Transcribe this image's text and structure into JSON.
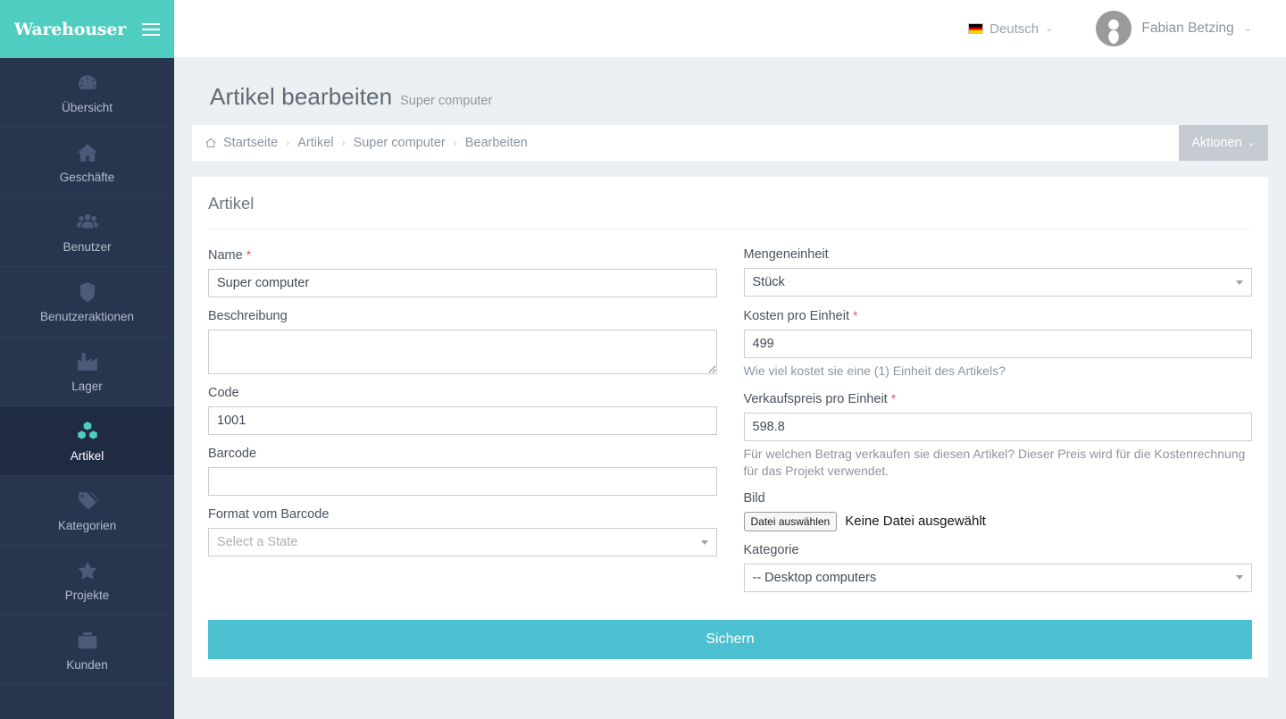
{
  "brand": {
    "name": "Warehouser"
  },
  "sidebar": {
    "items": [
      {
        "label": "Übersicht",
        "icon": "dashboard-icon",
        "active": false
      },
      {
        "label": "Geschäfte",
        "icon": "home-icon",
        "active": false
      },
      {
        "label": "Benutzer",
        "icon": "users-icon",
        "active": false
      },
      {
        "label": "Benutzeraktionen",
        "icon": "shield-icon",
        "active": false
      },
      {
        "label": "Lager",
        "icon": "factory-icon",
        "active": false
      },
      {
        "label": "Artikel",
        "icon": "boxes-icon",
        "active": true
      },
      {
        "label": "Kategorien",
        "icon": "tags-icon",
        "active": false
      },
      {
        "label": "Projekte",
        "icon": "star-icon",
        "active": false
      },
      {
        "label": "Kunden",
        "icon": "briefcase-icon",
        "active": false
      }
    ]
  },
  "topbar": {
    "language": "Deutsch",
    "language_flag": "de-flag-icon",
    "user_name": "Fabian Betzing",
    "avatar": "user-avatar-icon"
  },
  "page": {
    "title": "Artikel bearbeiten",
    "subtitle": "Super computer"
  },
  "breadcrumb": {
    "home_icon": "home-icon",
    "items": [
      "Startseite",
      "Artikel",
      "Super computer",
      "Bearbeiten"
    ],
    "separator": "›",
    "actions_label": "Aktionen"
  },
  "form": {
    "card_title": "Artikel",
    "name": {
      "label": "Name",
      "required": true,
      "value": "Super computer"
    },
    "description": {
      "label": "Beschreibung",
      "required": false,
      "value": ""
    },
    "code": {
      "label": "Code",
      "required": false,
      "value": "1001"
    },
    "barcode": {
      "label": "Barcode",
      "required": false,
      "value": ""
    },
    "barcode_format": {
      "label": "Format vom Barcode",
      "required": false,
      "value": "Select a State",
      "is_placeholder": true
    },
    "unit": {
      "label": "Mengeneinheit",
      "required": false,
      "value": "Stück"
    },
    "cost_per_unit": {
      "label": "Kosten pro Einheit",
      "required": true,
      "value": "499",
      "hint": "Wie viel kostet sie eine (1) Einheit des Artikels?"
    },
    "sale_price_per_unit": {
      "label": "Verkaufspreis pro Einheit",
      "required": true,
      "value": "598.8",
      "hint": "Für welchen Betrag verkaufen sie diesen Artikel? Dieser Preis wird für die Kostenrechnung für das Projekt verwendet."
    },
    "image": {
      "label": "Bild",
      "button_label": "Datei auswählen",
      "status_text": "Keine Datei ausgewählt"
    },
    "category": {
      "label": "Kategorie",
      "value": "-- Desktop computers"
    },
    "submit_label": "Sichern"
  },
  "colors": {
    "brand_teal": "#4ecdc0",
    "sidebar_bg": "#27354f",
    "sidebar_active_bg": "#1f2b42",
    "save_button": "#4cc0d0",
    "required_star": "#e4565f",
    "page_bg": "#ecf0f3",
    "actions_button": "#c4cbd2"
  }
}
